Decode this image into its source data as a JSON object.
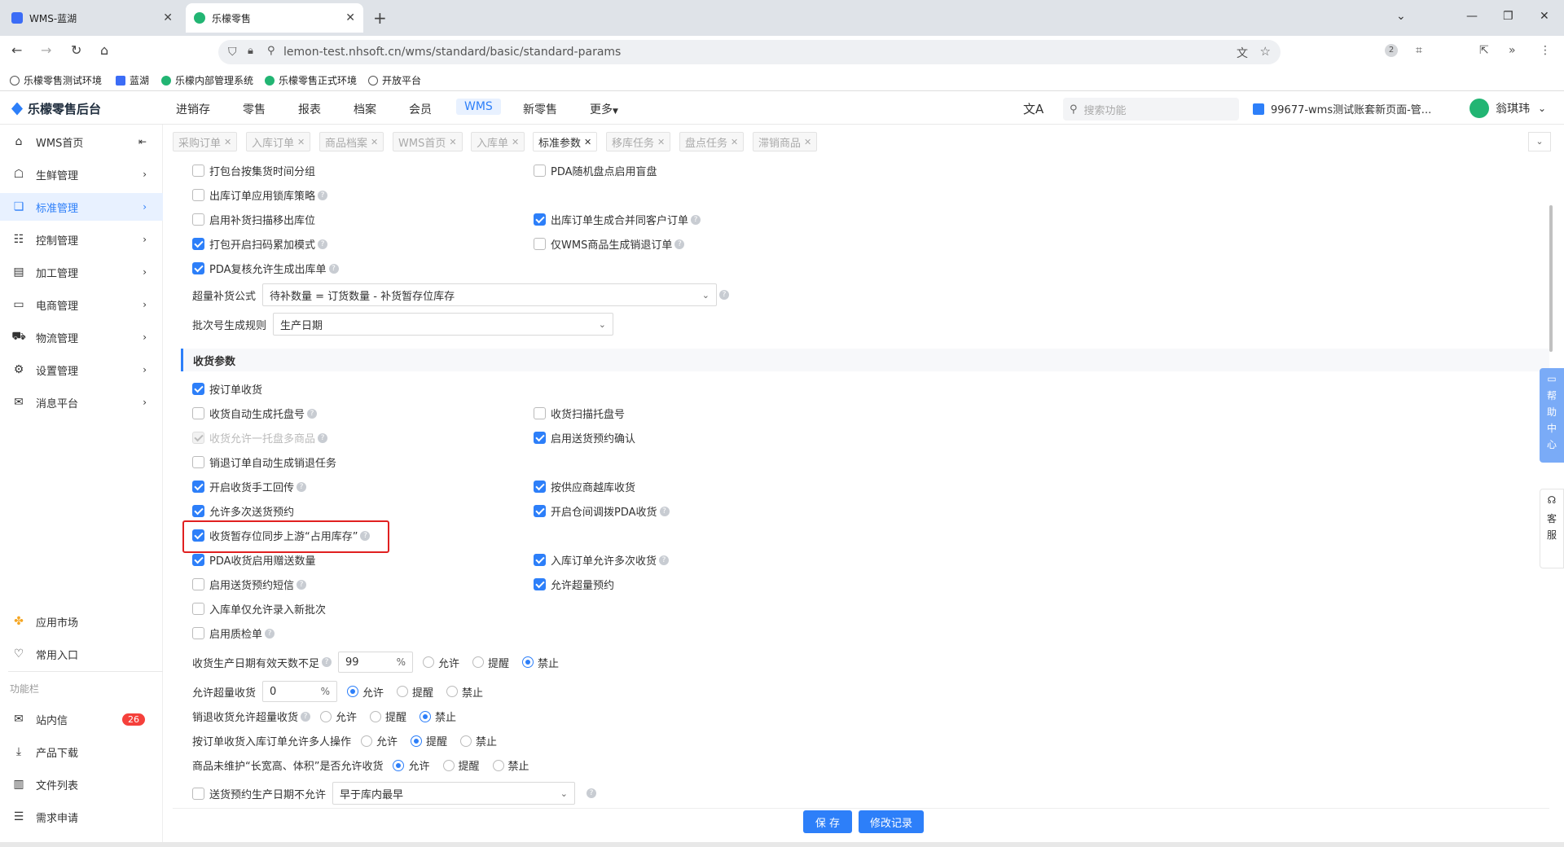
{
  "browser": {
    "tabs": [
      {
        "title": "WMS-蓝湖",
        "close": "✕"
      },
      {
        "title": "乐檬零售",
        "close": "✕"
      }
    ],
    "new_tab": "+",
    "url": "lemon-test.nhsoft.cn/wms/standard/basic/standard-params",
    "ext_badge": "2",
    "bookmarks": [
      "乐檬零售测试环境",
      "蓝湖",
      "乐檬内部管理系统",
      "乐檬零售正式环境",
      "开放平台"
    ]
  },
  "app": {
    "logo": "乐檬零售后台",
    "topnav": [
      "进销存",
      "零售",
      "报表",
      "档案",
      "会员",
      "WMS",
      "新零售",
      "更多"
    ],
    "active_nav": "WMS",
    "search_placeholder": "搜索功能",
    "account": "99677-wms测试账套新页面-管...",
    "user": "翁琪玮"
  },
  "sidebar": {
    "items": [
      {
        "label": "WMS首页",
        "icon": "home-icon"
      },
      {
        "label": "生鲜管理",
        "icon": "fresh-icon"
      },
      {
        "label": "标准管理",
        "icon": "standard-icon"
      },
      {
        "label": "控制管理",
        "icon": "control-icon"
      },
      {
        "label": "加工管理",
        "icon": "process-icon"
      },
      {
        "label": "电商管理",
        "icon": "ecommerce-icon"
      },
      {
        "label": "物流管理",
        "icon": "truck-icon"
      },
      {
        "label": "设置管理",
        "icon": "settings-icon"
      },
      {
        "label": "消息平台",
        "icon": "message-icon"
      }
    ],
    "bottom": [
      {
        "label": "应用市场",
        "icon": "app-market-icon"
      },
      {
        "label": "常用入口",
        "icon": "heart-icon"
      }
    ],
    "group_label": "功能栏",
    "functions": [
      {
        "label": "站内信",
        "badge": "26"
      },
      {
        "label": "产品下载"
      },
      {
        "label": "文件列表"
      },
      {
        "label": "需求申请"
      }
    ]
  },
  "page_tabs": [
    "采购订单",
    "入库订单",
    "商品档案",
    "WMS首页",
    "入库单",
    "标准参数",
    "移库任务",
    "盘点任务",
    "滞销商品"
  ],
  "active_page_tab": "标准参数",
  "params": {
    "top_rows": [
      {
        "left": {
          "label": "打包台按集货时间分组",
          "checked": false,
          "help": false
        },
        "right": {
          "label": "PDA随机盘点启用盲盘",
          "checked": false,
          "help": false
        }
      },
      {
        "left": {
          "label": "出库订单应用锁库策略",
          "checked": false,
          "help": true
        },
        "right": null
      },
      {
        "left": {
          "label": "启用补货扫描移出库位",
          "checked": false,
          "help": false
        },
        "right": {
          "label": "出库订单生成合并同客户订单",
          "checked": true,
          "help": true
        }
      },
      {
        "left": {
          "label": "打包开启扫码累加模式",
          "checked": true,
          "help": true
        },
        "right": {
          "label": "仅WMS商品生成销退订单",
          "checked": false,
          "help": true
        }
      },
      {
        "left": {
          "label": "PDA复核允许生成出库单",
          "checked": true,
          "help": true
        },
        "right": null
      }
    ],
    "over_replenish_label": "超量补货公式",
    "over_replenish_value": "待补数量 = 订货数量 - 补货暂存位库存",
    "batch_rule_label": "批次号生成规则",
    "batch_rule_value": "生产日期",
    "section_title": "收货参数",
    "receive_rows": [
      {
        "left": {
          "label": "按订单收货",
          "checked": true,
          "help": false
        },
        "right": null
      },
      {
        "left": {
          "label": "收货自动生成托盘号",
          "checked": false,
          "help": true
        },
        "right": {
          "label": "收货扫描托盘号",
          "checked": false,
          "help": false
        }
      },
      {
        "left": {
          "label": "收货允许一托盘多商品",
          "checked": true,
          "disabled": true,
          "help": true
        },
        "right": {
          "label": "启用送货预约确认",
          "checked": true,
          "help": false
        }
      },
      {
        "left": {
          "label": "销退订单自动生成销退任务",
          "checked": false,
          "help": false
        },
        "right": null
      },
      {
        "left": {
          "label": "开启收货手工回传",
          "checked": true,
          "help": true
        },
        "right": {
          "label": "按供应商越库收货",
          "checked": true,
          "help": false
        }
      },
      {
        "left": {
          "label": "允许多次送货预约",
          "checked": true,
          "help": false
        },
        "right": {
          "label": "开启仓间调拨PDA收货",
          "checked": true,
          "help": true
        }
      },
      {
        "left": {
          "label": "收货暂存位同步上游“占用库存”",
          "checked": true,
          "help": true
        },
        "right": null
      },
      {
        "left": {
          "label": "PDA收货启用赠送数量",
          "checked": true,
          "help": false
        },
        "right": {
          "label": "入库订单允许多次收货",
          "checked": true,
          "help": true
        }
      },
      {
        "left": {
          "label": "启用送货预约短信",
          "checked": false,
          "help": true
        },
        "right": {
          "label": "允许超量预约",
          "checked": true,
          "help": false
        }
      },
      {
        "left": {
          "label": "入库单仅允许录入新批次",
          "checked": false,
          "help": false
        },
        "right": null
      },
      {
        "left": {
          "label": "启用质检单",
          "checked": false,
          "help": true
        },
        "right": null
      }
    ],
    "radio_rows": [
      {
        "label": "收货生产日期有效天数不足",
        "help": true,
        "input": "99",
        "unit": "%",
        "options": [
          "允许",
          "提醒",
          "禁止"
        ],
        "selected": "禁止"
      },
      {
        "label": "允许超量收货",
        "help": false,
        "input": "0",
        "unit": "%",
        "options": [
          "允许",
          "提醒",
          "禁止"
        ],
        "selected": "允许"
      },
      {
        "label": "销退收货允许超量收货",
        "help": true,
        "input": null,
        "options": [
          "允许",
          "提醒",
          "禁止"
        ],
        "selected": "禁止"
      },
      {
        "label": "按订单收货入库订单允许多人操作",
        "help": false,
        "input": null,
        "options": [
          "允许",
          "提醒",
          "禁止"
        ],
        "selected": "提醒"
      },
      {
        "label": "商品未维护“长宽高、体积”是否允许收货",
        "help": false,
        "input": null,
        "options": [
          "允许",
          "提醒",
          "禁止"
        ],
        "selected": "允许"
      }
    ],
    "last_row_label": "送货预约生产日期不允许",
    "last_row_value": "早于库内最早"
  },
  "footer": {
    "save": "保 存",
    "history": "修改记录"
  },
  "help_center": [
    "帮",
    "助",
    "中",
    "心"
  ],
  "customer_service": [
    "客",
    "服"
  ]
}
